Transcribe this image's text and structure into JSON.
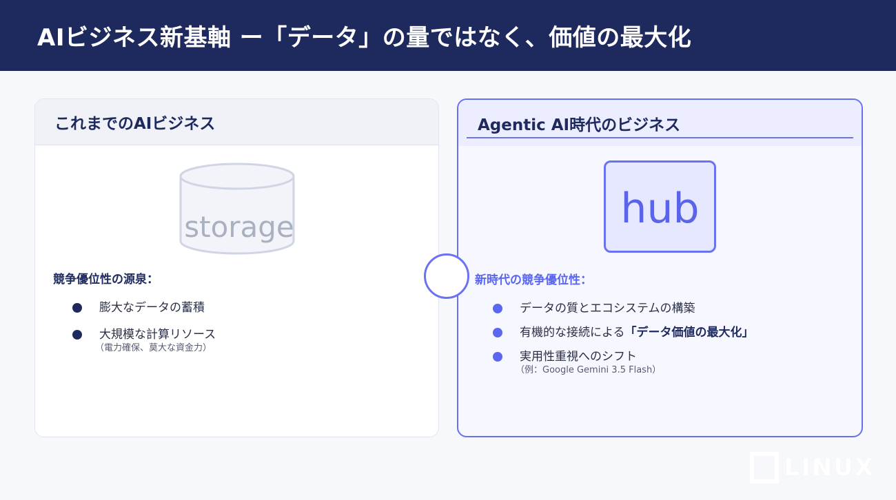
{
  "header": {
    "title": "AIビジネス新基軸 ー「データ」の量ではなく、価値の最大化"
  },
  "left": {
    "title": "これまでのAIビジネス",
    "icon": {
      "name": "storage-icon",
      "label": "storage"
    },
    "section_title": "競争優位性の源泉：",
    "items": [
      {
        "text": "膨大なデータの蓄積"
      },
      {
        "text": "大規模な計算リソース",
        "sub": "（電力確保、莫大な資金力）"
      }
    ]
  },
  "right": {
    "title": "Agentic AI時代のビジネス",
    "icon": {
      "name": "hub-icon",
      "label": "hub"
    },
    "section_title": "新時代の競争優位性：",
    "items": [
      {
        "text": "データの質とエコシステムの構築"
      },
      {
        "text_prefix": "有機的な接続による",
        "text_bold": "「データ価値の最大化」"
      },
      {
        "text": "実用性重視へのシフト",
        "sub": "（例：Google Gemini 3.5 Flash）"
      }
    ]
  },
  "logo": {
    "text": "LINUX"
  },
  "colors": {
    "header_bg": "#1e2a5e",
    "accent": "#6b72ef",
    "bullet_dark": "#1e2a5e"
  }
}
